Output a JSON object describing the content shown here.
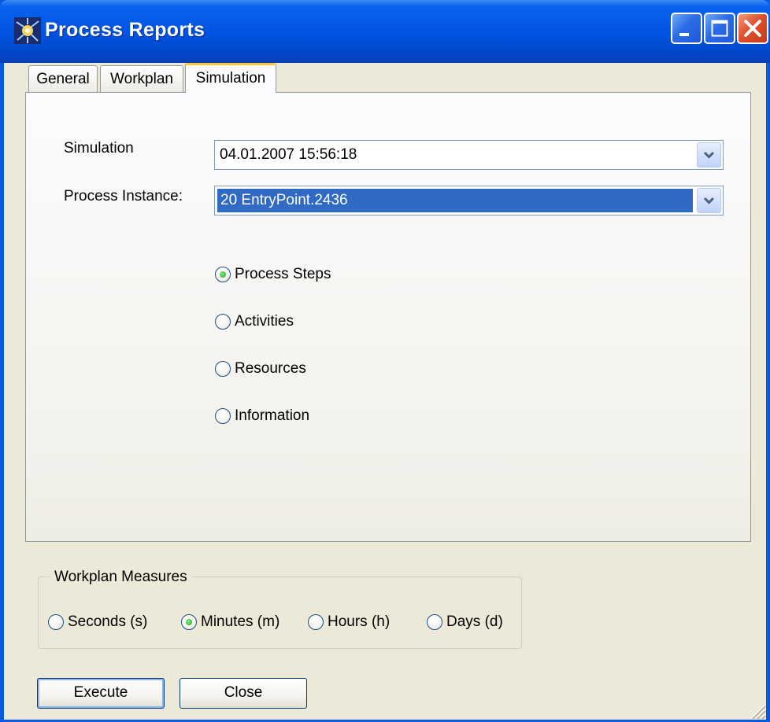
{
  "window": {
    "title": "Process Reports"
  },
  "tabs": [
    {
      "label": "General",
      "active": false
    },
    {
      "label": "Workplan",
      "active": false
    },
    {
      "label": "Simulation",
      "active": true
    }
  ],
  "simulation_tab": {
    "simulation_label": "Simulation",
    "simulation_value": "04.01.2007 15:56:18",
    "process_instance_label": "Process Instance:",
    "process_instance_value": "20 EntryPoint.2436",
    "report_options": [
      {
        "label": "Process Steps",
        "selected": true
      },
      {
        "label": "Activities",
        "selected": false
      },
      {
        "label": "Resources",
        "selected": false
      },
      {
        "label": "Information",
        "selected": false
      }
    ]
  },
  "workplan_measures": {
    "title": "Workplan Measures",
    "options": [
      {
        "label": "Seconds (s)",
        "selected": false
      },
      {
        "label": "Minutes (m)",
        "selected": true
      },
      {
        "label": "Hours (h)",
        "selected": false
      },
      {
        "label": "Days (d)",
        "selected": false
      }
    ]
  },
  "buttons": {
    "execute": "Execute",
    "close": "Close"
  },
  "colors": {
    "titlebar": "#0052e0",
    "selection": "#316ac5",
    "face": "#ece9d8",
    "active_tab_accent": "#ffc83c"
  }
}
